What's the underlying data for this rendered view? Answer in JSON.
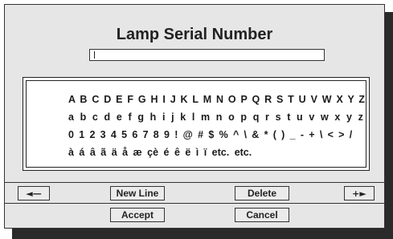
{
  "dialog": {
    "title": "Lamp Serial Number",
    "input_value": ""
  },
  "keyboard": {
    "rows": [
      "A B C D E F G H I J K L M N O P Q R S T U V W X Y Z",
      "a b c d e f g h i j k l m n o p q r s t u v w x y z",
      "0 1 2 3 4 5 6 7 8 9 ! @ # $ % ^ \\ & * ( ) _ - + \\ < > /",
      "à á â ã ä å æ çè é ê ë ì ï etc. etc."
    ]
  },
  "controls": {
    "left_arrow": "◄—",
    "right_arrow": "+►",
    "new_line_label": "New Line",
    "delete_label": "Delete",
    "accept_label": "Accept",
    "cancel_label": "Cancel"
  }
}
